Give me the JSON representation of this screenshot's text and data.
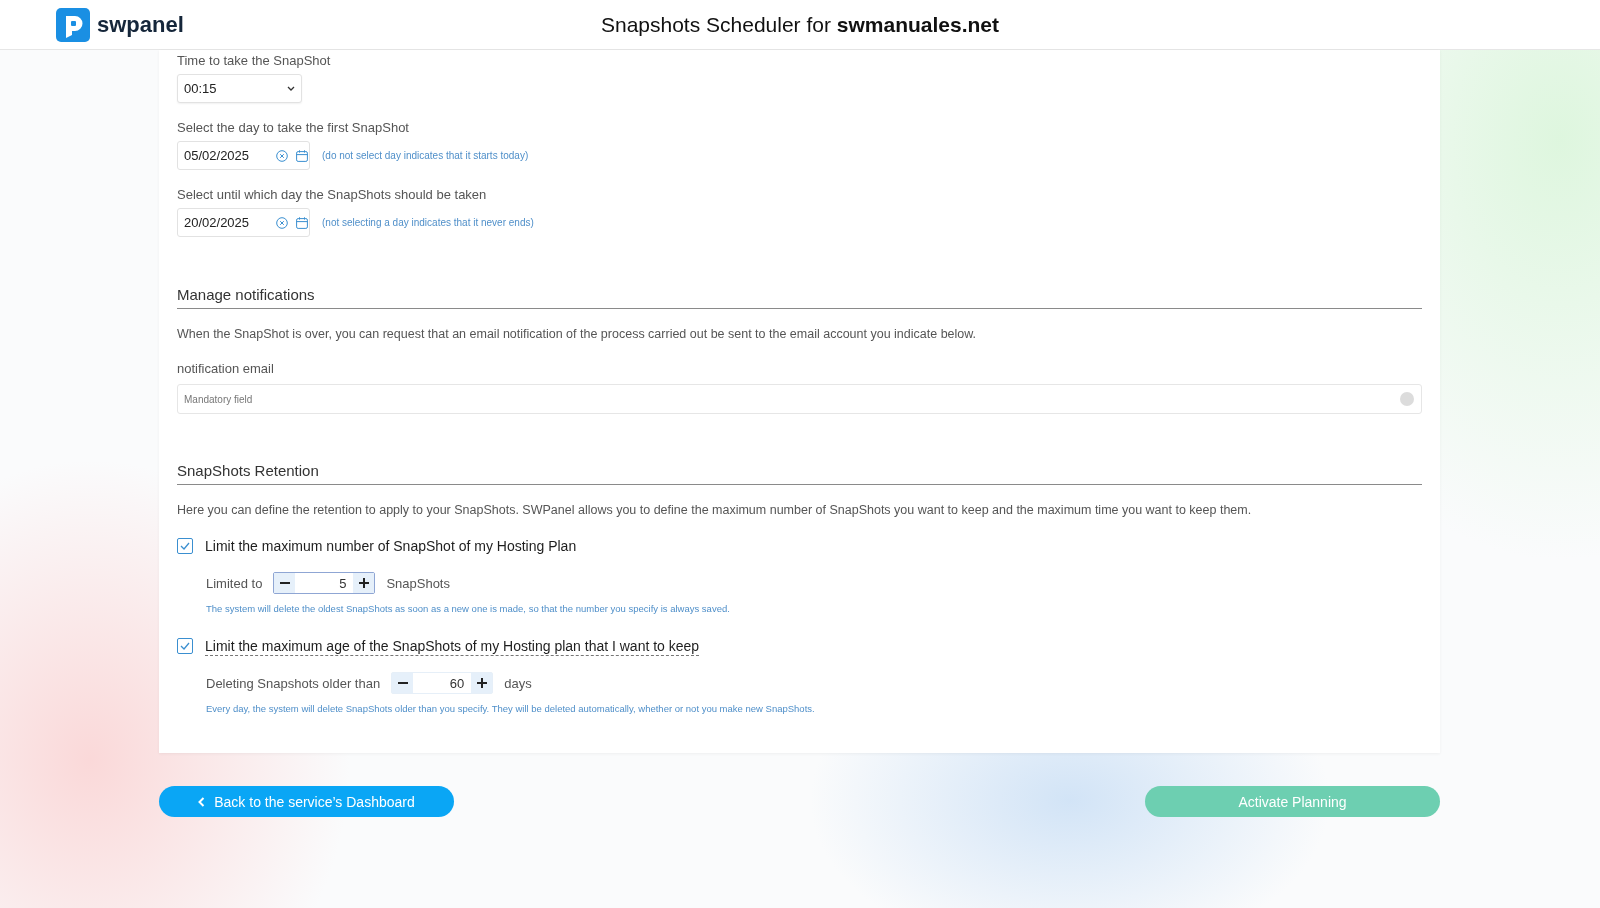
{
  "header": {
    "logo_text": "swpanel",
    "title": "Snapshots Scheduler for **swmanuales.net**"
  },
  "schedule": {
    "time": {
      "label": "Time to take the SnapShot",
      "value": "00:15"
    },
    "date_fields": [
      {
        "label": "Select the day to take the first SnapShot",
        "value": "05/02/2025",
        "hint": "(do not select day indicates that it starts today)"
      },
      {
        "label": "Select until which day the SnapShots should be taken",
        "value": "20/02/2025",
        "hint": "(not selecting a day indicates that it never ends)"
      }
    ]
  },
  "notifications": {
    "heading": "Manage notifications",
    "description": "When the SnapShot is over, you can request that an email notification of the process carried out be sent to the email account you indicate below.",
    "email": {
      "label": "notification email",
      "placeholder": "Mandatory field"
    }
  },
  "retention": {
    "heading": "SnapShots Retention",
    "description": "Here you can define the retention to apply to your SnapShots. SWPanel allows you to define the maximum number of SnapShots you want to keep and the maximum time you want to keep them.",
    "options": [
      {
        "label": "Limit the maximum number of SnapShot of my Hosting Plan",
        "checked": true,
        "underlined": false,
        "limit_label": "Limited to",
        "value": "5",
        "unit": "SnapShots",
        "focused": true,
        "hint": "The system will delete the oldest SnapShots as soon as a new one is made, so that the number you specify is always saved."
      },
      {
        "label": "Limit the maximum age of the SnapShots of my Hosting plan that I want to keep",
        "checked": true,
        "underlined": true,
        "limit_label": "Deleting Snapshots older than",
        "value": "60",
        "unit": "days",
        "focused": false,
        "hint": "Every day, the system will delete SnapShots older than you specify. They will be deleted automatically, whether or not you make new SnapShots."
      }
    ]
  },
  "buttons": [
    {
      "label": "Back to the service’s Dashboard",
      "kind": "back",
      "disabled": false
    },
    {
      "label": "Activate Planning",
      "kind": "primary",
      "disabled": true
    }
  ]
}
